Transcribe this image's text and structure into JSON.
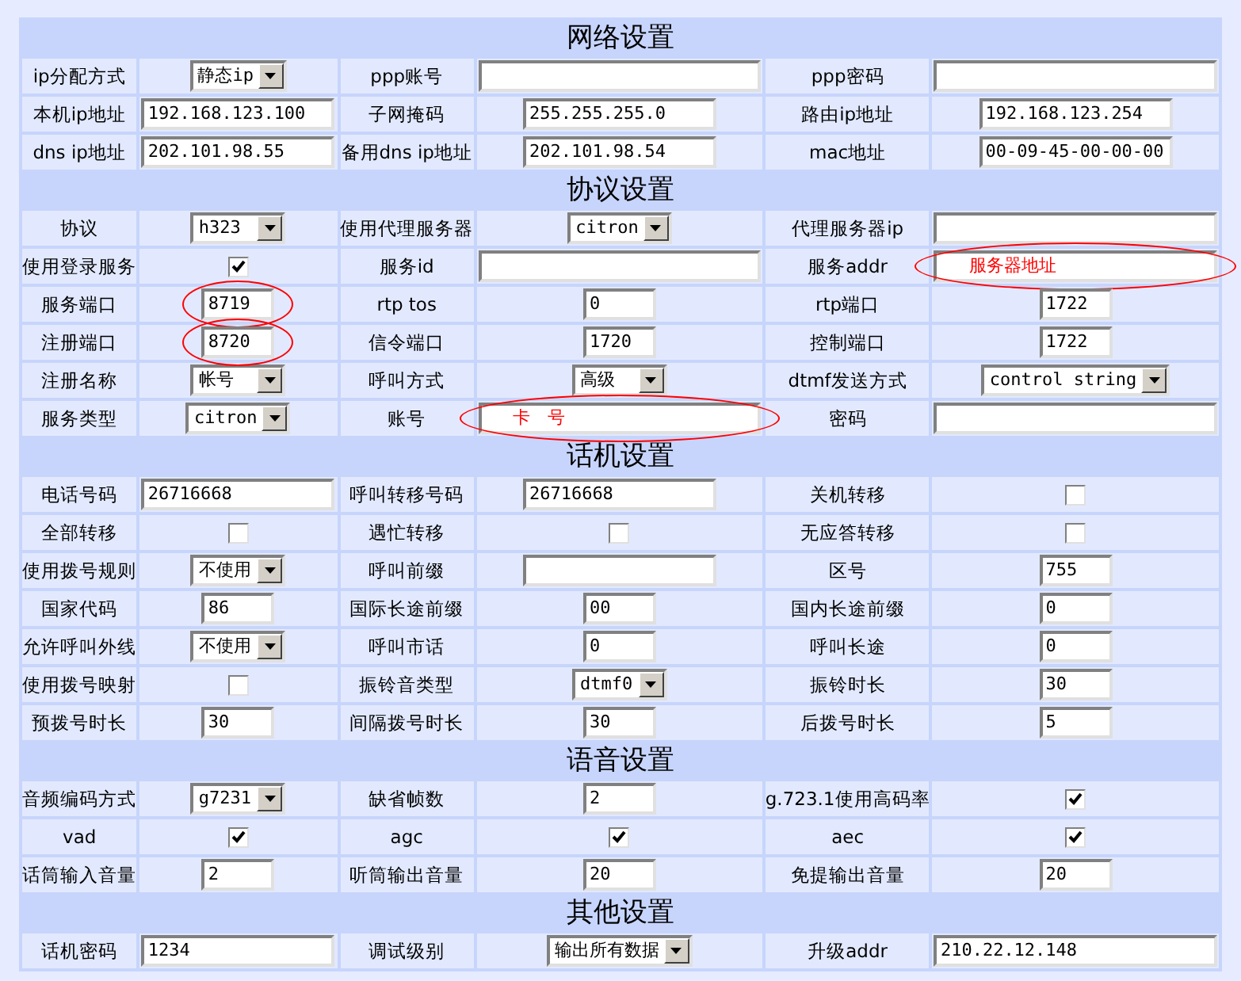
{
  "sections": [
    {
      "title": "网络设置",
      "rows": [
        [
          {
            "kind": "label",
            "text": "ip分配方式"
          },
          {
            "kind": "select",
            "value": "静态ip"
          },
          {
            "kind": "label",
            "text": "ppp账号"
          },
          {
            "kind": "wide_input"
          },
          {
            "kind": "label",
            "text": "ppp密码"
          },
          {
            "kind": "wide_input"
          }
        ],
        [
          {
            "kind": "label",
            "text": "本机ip地址"
          },
          {
            "kind": "input",
            "value": "192.168.123.100"
          },
          {
            "kind": "label",
            "text": "子网掩码"
          },
          {
            "kind": "input",
            "value": "255.255.255.0"
          },
          {
            "kind": "label",
            "text": "路由ip地址"
          },
          {
            "kind": "input",
            "value": "192.168.123.254"
          }
        ],
        [
          {
            "kind": "label",
            "text": "dns ip地址"
          },
          {
            "kind": "input",
            "value": "202.101.98.55"
          },
          {
            "kind": "label",
            "text": "备用dns ip地址"
          },
          {
            "kind": "input",
            "value": "202.101.98.54"
          },
          {
            "kind": "label",
            "text": "mac地址"
          },
          {
            "kind": "input",
            "value": "00-09-45-00-00-00"
          }
        ]
      ]
    },
    {
      "title": "协议设置",
      "rows": [
        [
          {
            "kind": "label",
            "text": "协议"
          },
          {
            "kind": "select",
            "value": "h323"
          },
          {
            "kind": "label",
            "text": "使用代理服务器"
          },
          {
            "kind": "select",
            "value": "citron"
          },
          {
            "kind": "label",
            "text": "代理服务器ip"
          },
          {
            "kind": "wide_input"
          }
        ],
        [
          {
            "kind": "label",
            "text": "使用登录服务"
          },
          {
            "kind": "checkbox",
            "checked": true
          },
          {
            "kind": "label",
            "text": "服务id"
          },
          {
            "kind": "wide_input"
          },
          {
            "kind": "label",
            "text": "服务addr"
          },
          {
            "kind": "wide_input",
            "note": "服务器地址",
            "circled": true
          }
        ],
        [
          {
            "kind": "label",
            "text": "服务端口"
          },
          {
            "kind": "short_input",
            "value": "8719",
            "circled": true
          },
          {
            "kind": "label",
            "text": "rtp tos"
          },
          {
            "kind": "short_input",
            "value": "0"
          },
          {
            "kind": "label",
            "text": "rtp端口"
          },
          {
            "kind": "short_input",
            "value": "1722"
          }
        ],
        [
          {
            "kind": "label",
            "text": "注册端口"
          },
          {
            "kind": "short_input",
            "value": "8720",
            "circled": true
          },
          {
            "kind": "label",
            "text": "信令端口"
          },
          {
            "kind": "short_input",
            "value": "1720"
          },
          {
            "kind": "label",
            "text": "控制端口"
          },
          {
            "kind": "short_input",
            "value": "1722"
          }
        ],
        [
          {
            "kind": "label",
            "text": "注册名称"
          },
          {
            "kind": "select",
            "value": "帐号"
          },
          {
            "kind": "label",
            "text": "呼叫方式"
          },
          {
            "kind": "select",
            "value": "高级"
          },
          {
            "kind": "label",
            "text": "dtmf发送方式"
          },
          {
            "kind": "select",
            "value": "control string"
          }
        ],
        [
          {
            "kind": "label",
            "text": "服务类型"
          },
          {
            "kind": "select",
            "value": "citron"
          },
          {
            "kind": "label",
            "text": "账号"
          },
          {
            "kind": "wide_input",
            "note": "卡　号",
            "circled": true
          },
          {
            "kind": "label",
            "text": "密码"
          },
          {
            "kind": "wide_input"
          }
        ]
      ]
    },
    {
      "title": "话机设置",
      "rows": [
        [
          {
            "kind": "label",
            "text": "电话号码"
          },
          {
            "kind": "input",
            "value": "26716668"
          },
          {
            "kind": "label",
            "text": "呼叫转移号码"
          },
          {
            "kind": "input",
            "value": "26716668"
          },
          {
            "kind": "label",
            "text": "关机转移"
          },
          {
            "kind": "checkbox",
            "checked": false
          }
        ],
        [
          {
            "kind": "label",
            "text": "全部转移"
          },
          {
            "kind": "checkbox",
            "checked": false
          },
          {
            "kind": "label",
            "text": "遇忙转移"
          },
          {
            "kind": "checkbox",
            "checked": false
          },
          {
            "kind": "label",
            "text": "无应答转移"
          },
          {
            "kind": "checkbox",
            "checked": false
          }
        ],
        [
          {
            "kind": "label",
            "text": "使用拨号规则"
          },
          {
            "kind": "select",
            "value": "不使用"
          },
          {
            "kind": "label",
            "text": "呼叫前缀"
          },
          {
            "kind": "input"
          },
          {
            "kind": "label",
            "text": "区号"
          },
          {
            "kind": "short_input",
            "value": "755"
          }
        ],
        [
          {
            "kind": "label",
            "text": "国家代码"
          },
          {
            "kind": "short_input",
            "value": "86"
          },
          {
            "kind": "label",
            "text": "国际长途前缀"
          },
          {
            "kind": "short_input",
            "value": "00"
          },
          {
            "kind": "label",
            "text": "国内长途前缀"
          },
          {
            "kind": "short_input",
            "value": "0"
          }
        ],
        [
          {
            "kind": "label",
            "text": "允许呼叫外线"
          },
          {
            "kind": "select",
            "value": "不使用"
          },
          {
            "kind": "label",
            "text": "呼叫市话"
          },
          {
            "kind": "short_input",
            "value": "0"
          },
          {
            "kind": "label",
            "text": "呼叫长途"
          },
          {
            "kind": "short_input",
            "value": "0"
          }
        ],
        [
          {
            "kind": "label",
            "text": "使用拨号映射"
          },
          {
            "kind": "checkbox",
            "checked": false
          },
          {
            "kind": "label",
            "text": "振铃音类型"
          },
          {
            "kind": "select",
            "value": "dtmf0"
          },
          {
            "kind": "label",
            "text": "振铃时长"
          },
          {
            "kind": "short_input",
            "value": "30"
          }
        ],
        [
          {
            "kind": "label",
            "text": "预拨号时长"
          },
          {
            "kind": "short_input",
            "value": "30"
          },
          {
            "kind": "label",
            "text": "间隔拨号时长"
          },
          {
            "kind": "short_input",
            "value": "30"
          },
          {
            "kind": "label",
            "text": "后拨号时长"
          },
          {
            "kind": "short_input",
            "value": "5"
          }
        ]
      ]
    },
    {
      "title": "语音设置",
      "rows": [
        [
          {
            "kind": "label",
            "text": "音频编码方式"
          },
          {
            "kind": "select",
            "value": "g7231"
          },
          {
            "kind": "label",
            "text": "缺省帧数"
          },
          {
            "kind": "short_input",
            "value": "2"
          },
          {
            "kind": "label",
            "text": "g.723.1使用高码率"
          },
          {
            "kind": "checkbox",
            "checked": true
          }
        ],
        [
          {
            "kind": "label",
            "text": "vad"
          },
          {
            "kind": "checkbox",
            "checked": true
          },
          {
            "kind": "label",
            "text": "agc"
          },
          {
            "kind": "checkbox",
            "checked": true
          },
          {
            "kind": "label",
            "text": "aec"
          },
          {
            "kind": "checkbox",
            "checked": true
          }
        ],
        [
          {
            "kind": "label",
            "text": "话筒输入音量"
          },
          {
            "kind": "short_input",
            "value": "2"
          },
          {
            "kind": "label",
            "text": "听筒输出音量"
          },
          {
            "kind": "short_input",
            "value": "20"
          },
          {
            "kind": "label",
            "text": "免提输出音量"
          },
          {
            "kind": "short_input",
            "value": "20"
          }
        ]
      ]
    },
    {
      "title": "其他设置",
      "rows": [
        [
          {
            "kind": "label",
            "text": "话机密码"
          },
          {
            "kind": "input",
            "value": "1234"
          },
          {
            "kind": "label",
            "text": "调试级别"
          },
          {
            "kind": "select",
            "value": "输出所有数据"
          },
          {
            "kind": "label",
            "text": "升级addr"
          },
          {
            "kind": "wide_input",
            "value": "210.22.12.148"
          }
        ]
      ]
    }
  ]
}
